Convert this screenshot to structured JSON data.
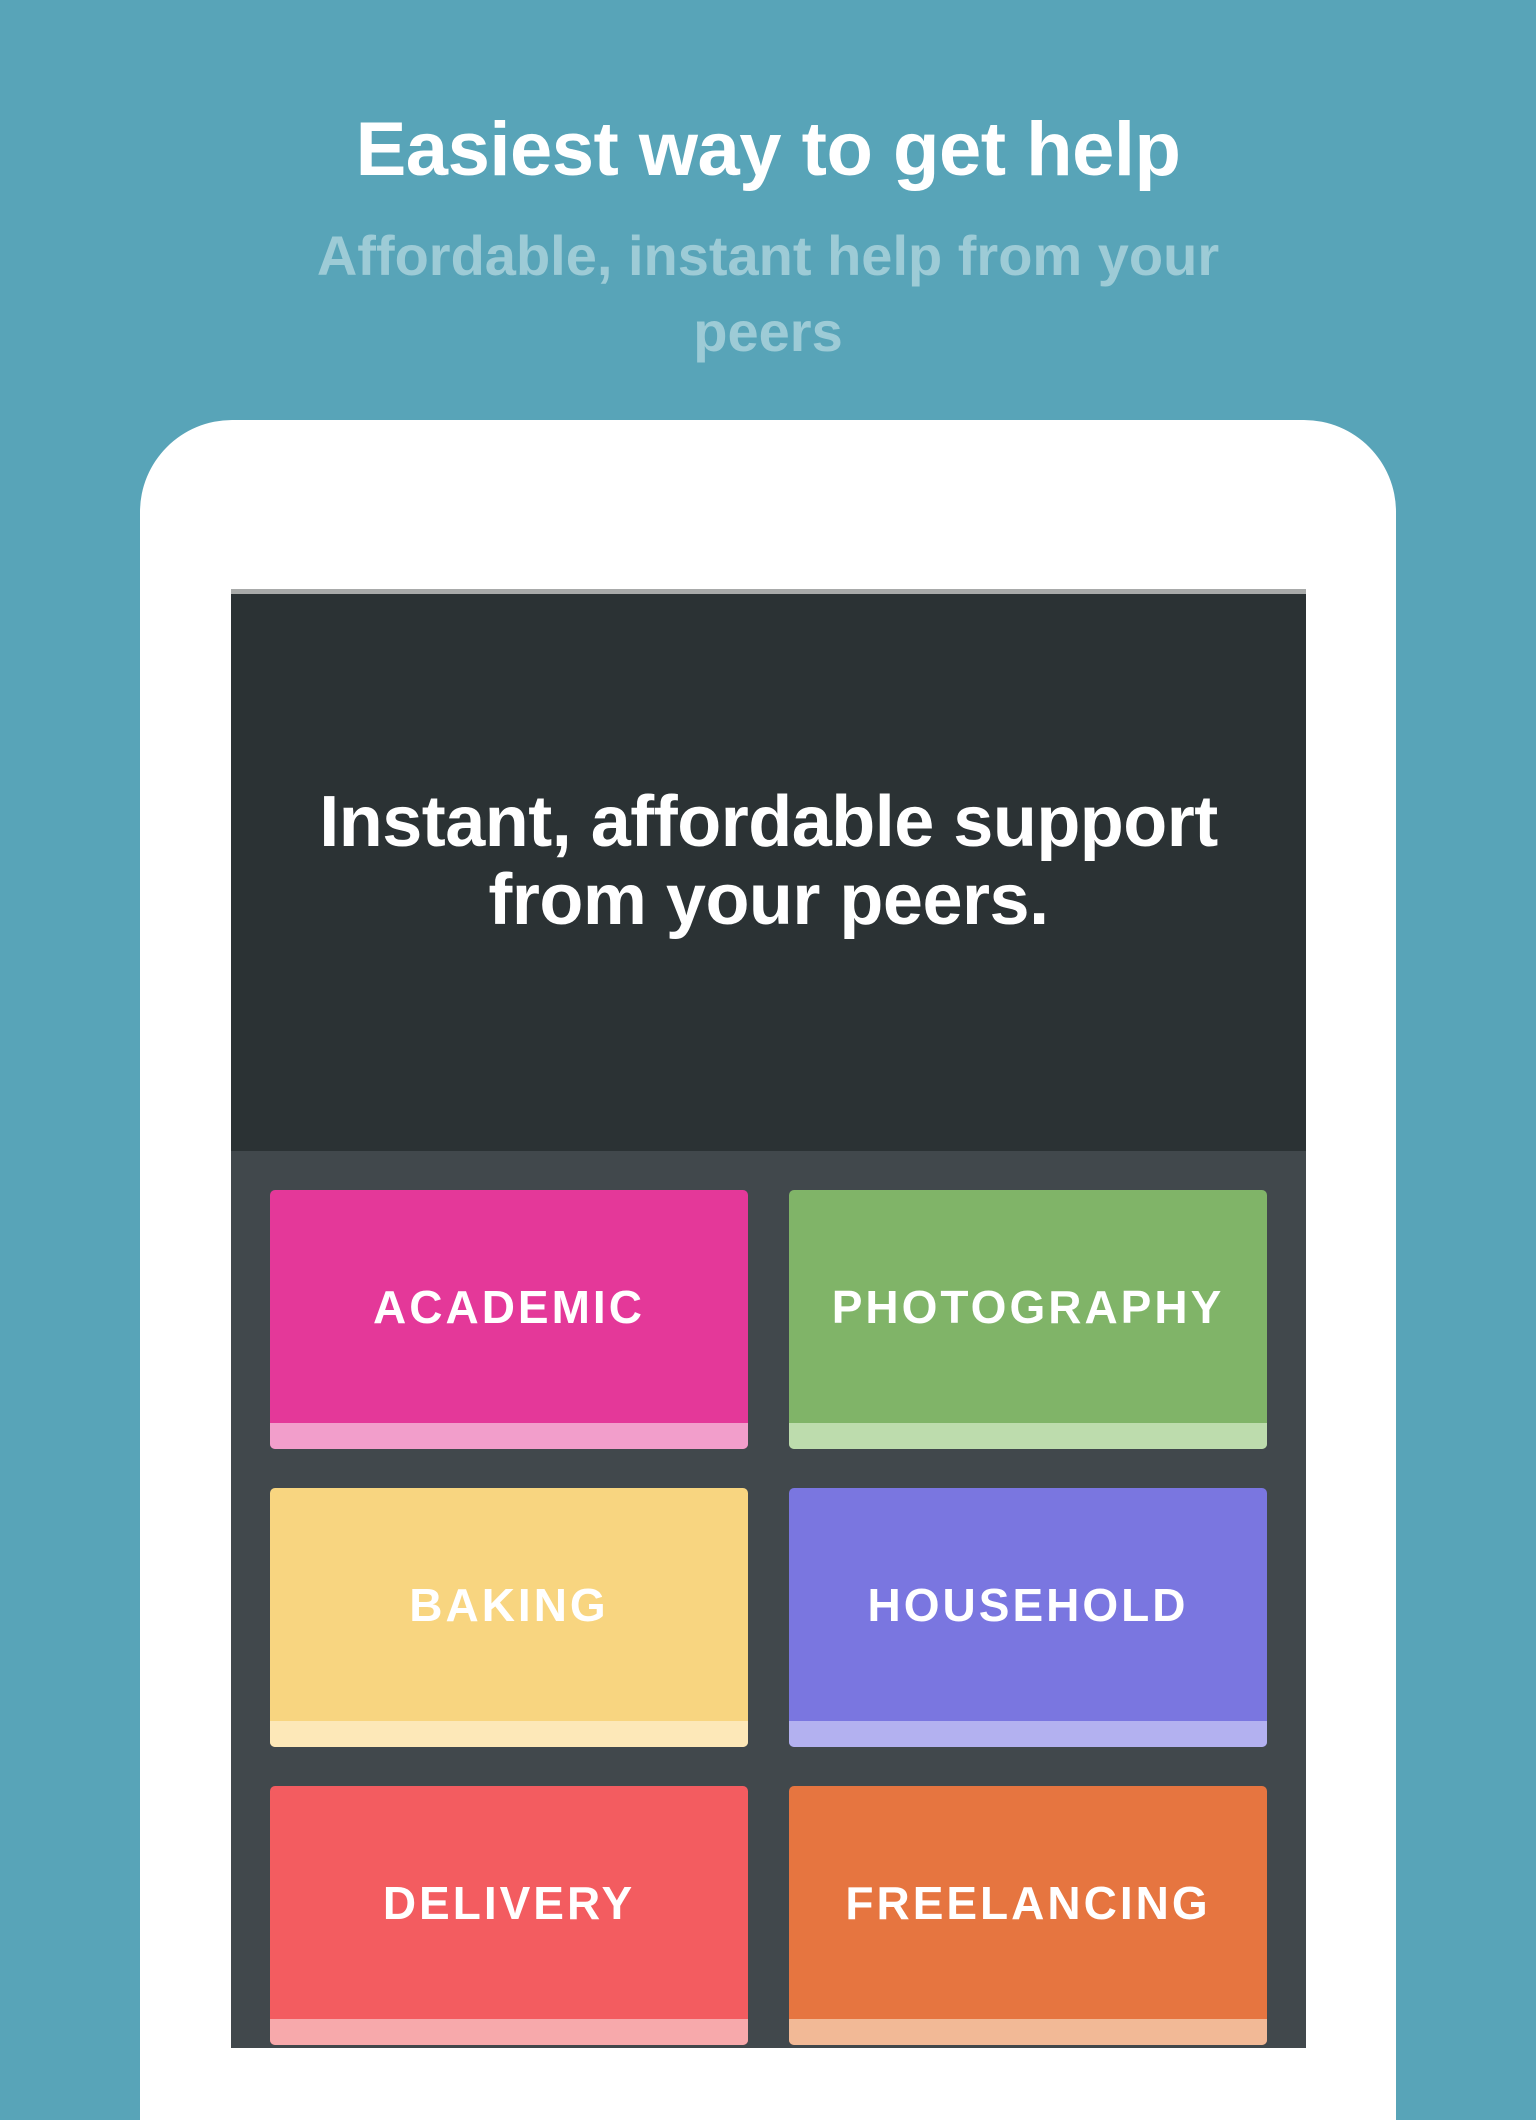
{
  "promo": {
    "title": "Easiest way to get help",
    "subtitle": "Affordable, instant help from your peers"
  },
  "app": {
    "hero_heading": "Instant, affordable support from your peers.",
    "categories": [
      {
        "label": "ACADEMIC",
        "color": "#e43899",
        "stripe_color": "#f29ecb"
      },
      {
        "label": "PHOTOGRAPHY",
        "color": "#80b468",
        "stripe_color": "#bddcad"
      },
      {
        "label": "BAKING",
        "color": "#f8d580",
        "stripe_color": "#fde8b8"
      },
      {
        "label": "HOUSEHOLD",
        "color": "#7a76e0",
        "stripe_color": "#b3b1f0"
      },
      {
        "label": "DELIVERY",
        "color": "#f35c60",
        "stripe_color": "#f7a9ab"
      },
      {
        "label": "FREELANCING",
        "color": "#e67540",
        "stripe_color": "#f2b996"
      }
    ]
  },
  "colors": {
    "background": "#58a4b8",
    "hero_background": "#2b3234",
    "grid_background": "#41484c"
  }
}
